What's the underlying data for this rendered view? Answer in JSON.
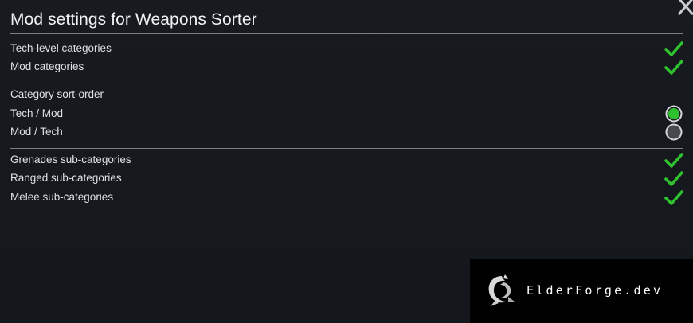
{
  "dialog": {
    "title": "Mod settings for Weapons Sorter",
    "close_icon": "close-icon"
  },
  "settings": {
    "tech_level_categories": {
      "label": "Tech-level categories",
      "checked": true
    },
    "mod_categories": {
      "label": "Mod categories",
      "checked": true
    },
    "sort_order": {
      "heading": "Category sort-order",
      "options": [
        {
          "label": "Tech / Mod",
          "selected": true
        },
        {
          "label": "Mod / Tech",
          "selected": false
        }
      ]
    },
    "grenades_sub_categories": {
      "label": "Grenades sub-categories",
      "checked": true
    },
    "ranged_sub_categories": {
      "label": "Ranged sub-categories",
      "checked": true
    },
    "melee_sub_categories": {
      "label": "Melee sub-categories",
      "checked": true
    }
  },
  "watermark": {
    "text": "ElderForge.dev",
    "logo_icon": "dragon-logo-icon"
  },
  "colors": {
    "check_green": "#2ec32e",
    "radio_selected": "#2ec32e",
    "radio_unselected": "#3a3d42",
    "background": "#15181d"
  }
}
